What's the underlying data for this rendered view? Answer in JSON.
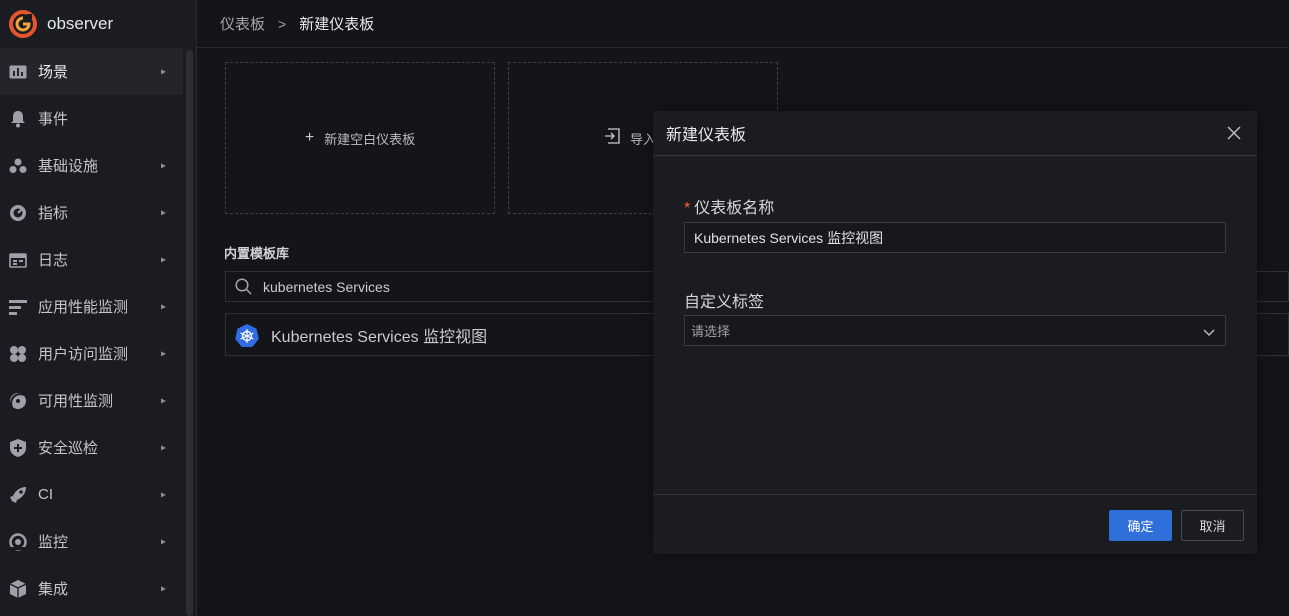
{
  "app": {
    "name": "observer"
  },
  "sidebar": {
    "items": [
      {
        "label": "场景",
        "icon": "dashboard-icon",
        "has_arrow": true
      },
      {
        "label": "事件",
        "icon": "bell-icon",
        "has_arrow": false
      },
      {
        "label": "基础设施",
        "icon": "cubes-icon",
        "has_arrow": true
      },
      {
        "label": "指标",
        "icon": "gauge-icon",
        "has_arrow": true
      },
      {
        "label": "日志",
        "icon": "calendar-icon",
        "has_arrow": true
      },
      {
        "label": "应用性能监测",
        "icon": "apm-icon",
        "has_arrow": true
      },
      {
        "label": "用户访问监测",
        "icon": "users-icon",
        "has_arrow": true
      },
      {
        "label": "可用性监测",
        "icon": "satellite-icon",
        "has_arrow": true
      },
      {
        "label": "安全巡检",
        "icon": "shield-icon",
        "has_arrow": true
      },
      {
        "label": "CI",
        "icon": "rocket-icon",
        "has_arrow": true
      },
      {
        "label": "监控",
        "icon": "monitor-icon",
        "has_arrow": true
      },
      {
        "label": "集成",
        "icon": "box-icon",
        "has_arrow": true
      }
    ]
  },
  "breadcrumb": {
    "parent": "仪表板",
    "separator": ">",
    "current": "新建仪表板"
  },
  "cards": {
    "new_blank": "新建空白仪表板",
    "import_custom": "导入自定"
  },
  "templates": {
    "section_title": "内置模板库",
    "search_value": "kubernetes Services",
    "items": [
      {
        "label": "Kubernetes Services 监控视图",
        "icon": "kubernetes-icon"
      }
    ]
  },
  "modal": {
    "title": "新建仪表板",
    "name_label": "仪表板名称",
    "required_mark": "*",
    "name_value": "Kubernetes Services 监控视图",
    "tags_label": "自定义标签",
    "tags_placeholder": "请选择",
    "confirm_label": "确定",
    "cancel_label": "取消"
  },
  "colors": {
    "accent": "#2e6fd9",
    "required": "#f0663a",
    "logo": "#e8542b"
  }
}
